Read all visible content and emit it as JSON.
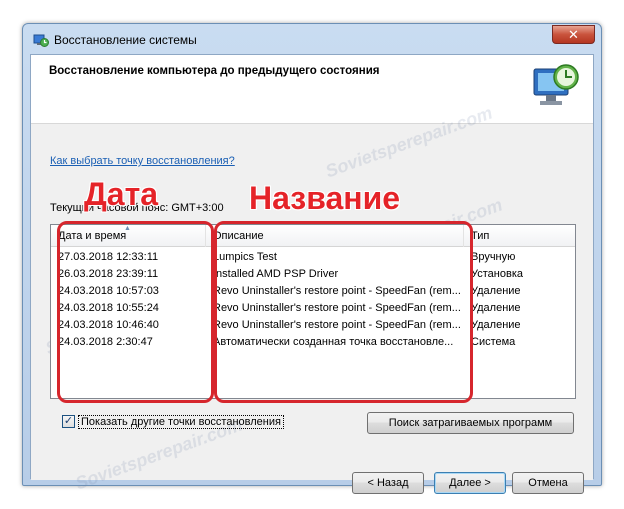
{
  "window": {
    "title": "Восстановление системы",
    "close_glyph": "✕"
  },
  "header": {
    "title": "Восстановление компьютера до предыдущего состояния",
    "icon": "system-restore-icon"
  },
  "help_link": "Как выбрать точку восстановления?",
  "timezone_label": "Текущий часовой пояс: GMT+3:00",
  "overlay": {
    "date_label": "Дата",
    "name_label": "Название",
    "color": "#e52328"
  },
  "table": {
    "columns": [
      "Дата и время",
      "Описание",
      "Тип"
    ],
    "rows": [
      {
        "date": "27.03.2018 12:33:11",
        "desc": "Lumpics Test",
        "type": "Вручную"
      },
      {
        "date": "26.03.2018 23:39:11",
        "desc": "Installed AMD PSP Driver",
        "type": "Установка"
      },
      {
        "date": "24.03.2018 10:57:03",
        "desc": "Revo Uninstaller's restore point - SpeedFan (rem...",
        "type": "Удаление"
      },
      {
        "date": "24.03.2018 10:55:24",
        "desc": "Revo Uninstaller's restore point - SpeedFan (rem...",
        "type": "Удаление"
      },
      {
        "date": "24.03.2018 10:46:40",
        "desc": "Revo Uninstaller's restore point - SpeedFan (rem...",
        "type": "Удаление"
      },
      {
        "date": "24.03.2018 2:30:47",
        "desc": "Автоматически созданная точка восстановле...",
        "type": "Система"
      }
    ]
  },
  "show_more": {
    "checked": true,
    "label": "Показать другие точки восстановления"
  },
  "buttons": {
    "search": "Поиск затрагиваемых программ",
    "back": "< Назад",
    "next": "Далее >",
    "cancel": "Отмена"
  },
  "watermark": "Sovietsperepair.com"
}
